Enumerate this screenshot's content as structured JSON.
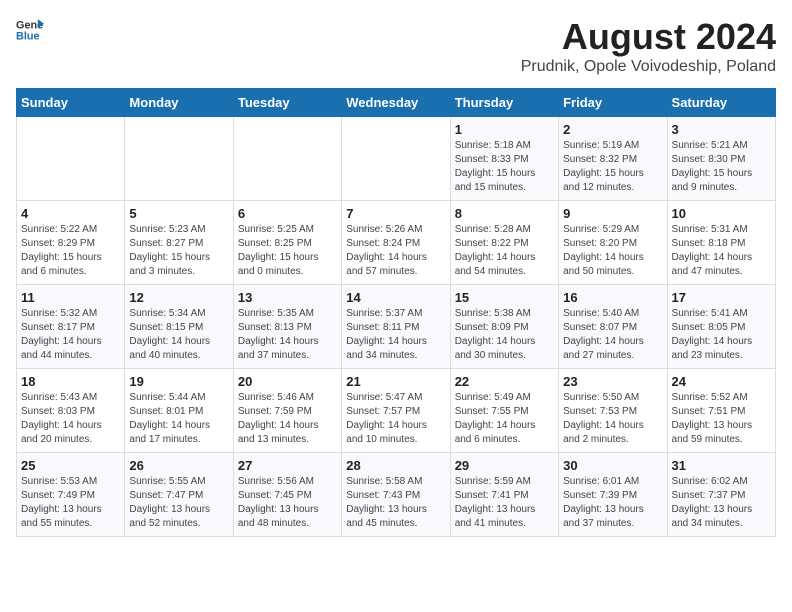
{
  "header": {
    "logo_general": "General",
    "logo_blue": "Blue",
    "month_year": "August 2024",
    "location": "Prudnik, Opole Voivodeship, Poland"
  },
  "weekdays": [
    "Sunday",
    "Monday",
    "Tuesday",
    "Wednesday",
    "Thursday",
    "Friday",
    "Saturday"
  ],
  "weeks": [
    [
      {
        "day": "",
        "sunrise": "",
        "sunset": "",
        "daylight": ""
      },
      {
        "day": "",
        "sunrise": "",
        "sunset": "",
        "daylight": ""
      },
      {
        "day": "",
        "sunrise": "",
        "sunset": "",
        "daylight": ""
      },
      {
        "day": "",
        "sunrise": "",
        "sunset": "",
        "daylight": ""
      },
      {
        "day": "1",
        "sunrise": "Sunrise: 5:18 AM",
        "sunset": "Sunset: 8:33 PM",
        "daylight": "Daylight: 15 hours and 15 minutes."
      },
      {
        "day": "2",
        "sunrise": "Sunrise: 5:19 AM",
        "sunset": "Sunset: 8:32 PM",
        "daylight": "Daylight: 15 hours and 12 minutes."
      },
      {
        "day": "3",
        "sunrise": "Sunrise: 5:21 AM",
        "sunset": "Sunset: 8:30 PM",
        "daylight": "Daylight: 15 hours and 9 minutes."
      }
    ],
    [
      {
        "day": "4",
        "sunrise": "Sunrise: 5:22 AM",
        "sunset": "Sunset: 8:29 PM",
        "daylight": "Daylight: 15 hours and 6 minutes."
      },
      {
        "day": "5",
        "sunrise": "Sunrise: 5:23 AM",
        "sunset": "Sunset: 8:27 PM",
        "daylight": "Daylight: 15 hours and 3 minutes."
      },
      {
        "day": "6",
        "sunrise": "Sunrise: 5:25 AM",
        "sunset": "Sunset: 8:25 PM",
        "daylight": "Daylight: 15 hours and 0 minutes."
      },
      {
        "day": "7",
        "sunrise": "Sunrise: 5:26 AM",
        "sunset": "Sunset: 8:24 PM",
        "daylight": "Daylight: 14 hours and 57 minutes."
      },
      {
        "day": "8",
        "sunrise": "Sunrise: 5:28 AM",
        "sunset": "Sunset: 8:22 PM",
        "daylight": "Daylight: 14 hours and 54 minutes."
      },
      {
        "day": "9",
        "sunrise": "Sunrise: 5:29 AM",
        "sunset": "Sunset: 8:20 PM",
        "daylight": "Daylight: 14 hours and 50 minutes."
      },
      {
        "day": "10",
        "sunrise": "Sunrise: 5:31 AM",
        "sunset": "Sunset: 8:18 PM",
        "daylight": "Daylight: 14 hours and 47 minutes."
      }
    ],
    [
      {
        "day": "11",
        "sunrise": "Sunrise: 5:32 AM",
        "sunset": "Sunset: 8:17 PM",
        "daylight": "Daylight: 14 hours and 44 minutes."
      },
      {
        "day": "12",
        "sunrise": "Sunrise: 5:34 AM",
        "sunset": "Sunset: 8:15 PM",
        "daylight": "Daylight: 14 hours and 40 minutes."
      },
      {
        "day": "13",
        "sunrise": "Sunrise: 5:35 AM",
        "sunset": "Sunset: 8:13 PM",
        "daylight": "Daylight: 14 hours and 37 minutes."
      },
      {
        "day": "14",
        "sunrise": "Sunrise: 5:37 AM",
        "sunset": "Sunset: 8:11 PM",
        "daylight": "Daylight: 14 hours and 34 minutes."
      },
      {
        "day": "15",
        "sunrise": "Sunrise: 5:38 AM",
        "sunset": "Sunset: 8:09 PM",
        "daylight": "Daylight: 14 hours and 30 minutes."
      },
      {
        "day": "16",
        "sunrise": "Sunrise: 5:40 AM",
        "sunset": "Sunset: 8:07 PM",
        "daylight": "Daylight: 14 hours and 27 minutes."
      },
      {
        "day": "17",
        "sunrise": "Sunrise: 5:41 AM",
        "sunset": "Sunset: 8:05 PM",
        "daylight": "Daylight: 14 hours and 23 minutes."
      }
    ],
    [
      {
        "day": "18",
        "sunrise": "Sunrise: 5:43 AM",
        "sunset": "Sunset: 8:03 PM",
        "daylight": "Daylight: 14 hours and 20 minutes."
      },
      {
        "day": "19",
        "sunrise": "Sunrise: 5:44 AM",
        "sunset": "Sunset: 8:01 PM",
        "daylight": "Daylight: 14 hours and 17 minutes."
      },
      {
        "day": "20",
        "sunrise": "Sunrise: 5:46 AM",
        "sunset": "Sunset: 7:59 PM",
        "daylight": "Daylight: 14 hours and 13 minutes."
      },
      {
        "day": "21",
        "sunrise": "Sunrise: 5:47 AM",
        "sunset": "Sunset: 7:57 PM",
        "daylight": "Daylight: 14 hours and 10 minutes."
      },
      {
        "day": "22",
        "sunrise": "Sunrise: 5:49 AM",
        "sunset": "Sunset: 7:55 PM",
        "daylight": "Daylight: 14 hours and 6 minutes."
      },
      {
        "day": "23",
        "sunrise": "Sunrise: 5:50 AM",
        "sunset": "Sunset: 7:53 PM",
        "daylight": "Daylight: 14 hours and 2 minutes."
      },
      {
        "day": "24",
        "sunrise": "Sunrise: 5:52 AM",
        "sunset": "Sunset: 7:51 PM",
        "daylight": "Daylight: 13 hours and 59 minutes."
      }
    ],
    [
      {
        "day": "25",
        "sunrise": "Sunrise: 5:53 AM",
        "sunset": "Sunset: 7:49 PM",
        "daylight": "Daylight: 13 hours and 55 minutes."
      },
      {
        "day": "26",
        "sunrise": "Sunrise: 5:55 AM",
        "sunset": "Sunset: 7:47 PM",
        "daylight": "Daylight: 13 hours and 52 minutes."
      },
      {
        "day": "27",
        "sunrise": "Sunrise: 5:56 AM",
        "sunset": "Sunset: 7:45 PM",
        "daylight": "Daylight: 13 hours and 48 minutes."
      },
      {
        "day": "28",
        "sunrise": "Sunrise: 5:58 AM",
        "sunset": "Sunset: 7:43 PM",
        "daylight": "Daylight: 13 hours and 45 minutes."
      },
      {
        "day": "29",
        "sunrise": "Sunrise: 5:59 AM",
        "sunset": "Sunset: 7:41 PM",
        "daylight": "Daylight: 13 hours and 41 minutes."
      },
      {
        "day": "30",
        "sunrise": "Sunrise: 6:01 AM",
        "sunset": "Sunset: 7:39 PM",
        "daylight": "Daylight: 13 hours and 37 minutes."
      },
      {
        "day": "31",
        "sunrise": "Sunrise: 6:02 AM",
        "sunset": "Sunset: 7:37 PM",
        "daylight": "Daylight: 13 hours and 34 minutes."
      }
    ]
  ]
}
